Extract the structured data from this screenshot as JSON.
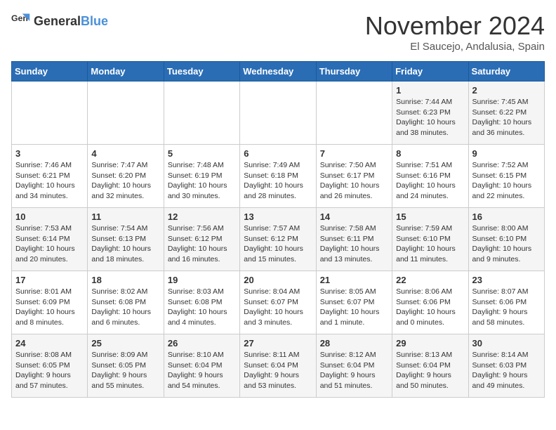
{
  "header": {
    "logo_general": "General",
    "logo_blue": "Blue",
    "month": "November 2024",
    "location": "El Saucejo, Andalusia, Spain"
  },
  "days_of_week": [
    "Sunday",
    "Monday",
    "Tuesday",
    "Wednesday",
    "Thursday",
    "Friday",
    "Saturday"
  ],
  "weeks": [
    [
      {
        "day": "",
        "info": ""
      },
      {
        "day": "",
        "info": ""
      },
      {
        "day": "",
        "info": ""
      },
      {
        "day": "",
        "info": ""
      },
      {
        "day": "",
        "info": ""
      },
      {
        "day": "1",
        "info": "Sunrise: 7:44 AM\nSunset: 6:23 PM\nDaylight: 10 hours and 38 minutes."
      },
      {
        "day": "2",
        "info": "Sunrise: 7:45 AM\nSunset: 6:22 PM\nDaylight: 10 hours and 36 minutes."
      }
    ],
    [
      {
        "day": "3",
        "info": "Sunrise: 7:46 AM\nSunset: 6:21 PM\nDaylight: 10 hours and 34 minutes."
      },
      {
        "day": "4",
        "info": "Sunrise: 7:47 AM\nSunset: 6:20 PM\nDaylight: 10 hours and 32 minutes."
      },
      {
        "day": "5",
        "info": "Sunrise: 7:48 AM\nSunset: 6:19 PM\nDaylight: 10 hours and 30 minutes."
      },
      {
        "day": "6",
        "info": "Sunrise: 7:49 AM\nSunset: 6:18 PM\nDaylight: 10 hours and 28 minutes."
      },
      {
        "day": "7",
        "info": "Sunrise: 7:50 AM\nSunset: 6:17 PM\nDaylight: 10 hours and 26 minutes."
      },
      {
        "day": "8",
        "info": "Sunrise: 7:51 AM\nSunset: 6:16 PM\nDaylight: 10 hours and 24 minutes."
      },
      {
        "day": "9",
        "info": "Sunrise: 7:52 AM\nSunset: 6:15 PM\nDaylight: 10 hours and 22 minutes."
      }
    ],
    [
      {
        "day": "10",
        "info": "Sunrise: 7:53 AM\nSunset: 6:14 PM\nDaylight: 10 hours and 20 minutes."
      },
      {
        "day": "11",
        "info": "Sunrise: 7:54 AM\nSunset: 6:13 PM\nDaylight: 10 hours and 18 minutes."
      },
      {
        "day": "12",
        "info": "Sunrise: 7:56 AM\nSunset: 6:12 PM\nDaylight: 10 hours and 16 minutes."
      },
      {
        "day": "13",
        "info": "Sunrise: 7:57 AM\nSunset: 6:12 PM\nDaylight: 10 hours and 15 minutes."
      },
      {
        "day": "14",
        "info": "Sunrise: 7:58 AM\nSunset: 6:11 PM\nDaylight: 10 hours and 13 minutes."
      },
      {
        "day": "15",
        "info": "Sunrise: 7:59 AM\nSunset: 6:10 PM\nDaylight: 10 hours and 11 minutes."
      },
      {
        "day": "16",
        "info": "Sunrise: 8:00 AM\nSunset: 6:10 PM\nDaylight: 10 hours and 9 minutes."
      }
    ],
    [
      {
        "day": "17",
        "info": "Sunrise: 8:01 AM\nSunset: 6:09 PM\nDaylight: 10 hours and 8 minutes."
      },
      {
        "day": "18",
        "info": "Sunrise: 8:02 AM\nSunset: 6:08 PM\nDaylight: 10 hours and 6 minutes."
      },
      {
        "day": "19",
        "info": "Sunrise: 8:03 AM\nSunset: 6:08 PM\nDaylight: 10 hours and 4 minutes."
      },
      {
        "day": "20",
        "info": "Sunrise: 8:04 AM\nSunset: 6:07 PM\nDaylight: 10 hours and 3 minutes."
      },
      {
        "day": "21",
        "info": "Sunrise: 8:05 AM\nSunset: 6:07 PM\nDaylight: 10 hours and 1 minute."
      },
      {
        "day": "22",
        "info": "Sunrise: 8:06 AM\nSunset: 6:06 PM\nDaylight: 10 hours and 0 minutes."
      },
      {
        "day": "23",
        "info": "Sunrise: 8:07 AM\nSunset: 6:06 PM\nDaylight: 9 hours and 58 minutes."
      }
    ],
    [
      {
        "day": "24",
        "info": "Sunrise: 8:08 AM\nSunset: 6:05 PM\nDaylight: 9 hours and 57 minutes."
      },
      {
        "day": "25",
        "info": "Sunrise: 8:09 AM\nSunset: 6:05 PM\nDaylight: 9 hours and 55 minutes."
      },
      {
        "day": "26",
        "info": "Sunrise: 8:10 AM\nSunset: 6:04 PM\nDaylight: 9 hours and 54 minutes."
      },
      {
        "day": "27",
        "info": "Sunrise: 8:11 AM\nSunset: 6:04 PM\nDaylight: 9 hours and 53 minutes."
      },
      {
        "day": "28",
        "info": "Sunrise: 8:12 AM\nSunset: 6:04 PM\nDaylight: 9 hours and 51 minutes."
      },
      {
        "day": "29",
        "info": "Sunrise: 8:13 AM\nSunset: 6:04 PM\nDaylight: 9 hours and 50 minutes."
      },
      {
        "day": "30",
        "info": "Sunrise: 8:14 AM\nSunset: 6:03 PM\nDaylight: 9 hours and 49 minutes."
      }
    ]
  ]
}
